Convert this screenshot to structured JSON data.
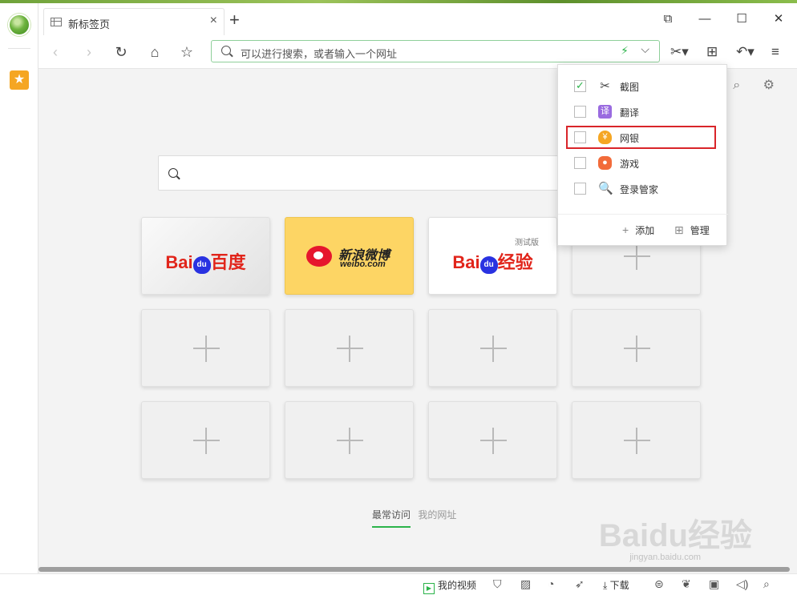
{
  "tab": {
    "title": "新标签页",
    "close": "×"
  },
  "new_tab": "+",
  "window_controls": {
    "restore": "⧉",
    "minimize": "—",
    "maximize": "☐",
    "close": "✕"
  },
  "nav": {
    "back": "‹",
    "forward": "›",
    "reload": "↻",
    "home": "⌂",
    "favorite": "☆"
  },
  "address": {
    "placeholder": "可以进行搜索，或者输入一个网址",
    "bolt": "⚡",
    "dropdown": "⌵"
  },
  "toolbar": {
    "scissors": "✂▾",
    "apps": "⊞",
    "undo": "↶▾",
    "menu": "≡"
  },
  "content_tools": {
    "search": "⌕",
    "settings": "⚙"
  },
  "tiles": [
    {
      "kind": "baidu",
      "brand_left": "Bai",
      "brand_paw": "du",
      "brand_right": "百度"
    },
    {
      "kind": "weibo",
      "cn": "新浪微博",
      "en": "weibo.com"
    },
    {
      "kind": "jingyan",
      "brand_left": "Bai",
      "brand_paw": "du",
      "brand_right": "经验",
      "beta": "测试版"
    },
    {
      "kind": "empty"
    },
    {
      "kind": "empty"
    },
    {
      "kind": "empty"
    },
    {
      "kind": "empty"
    },
    {
      "kind": "empty"
    },
    {
      "kind": "empty"
    },
    {
      "kind": "empty"
    },
    {
      "kind": "empty"
    },
    {
      "kind": "empty"
    }
  ],
  "bottom_tabs": [
    "最常访问",
    "我的网址"
  ],
  "watermark": {
    "text": "Baidu经验",
    "sub": "jingyan.baidu.com"
  },
  "statusbar": {
    "video": "我的视频",
    "download": "下载"
  },
  "dropdown": {
    "items": [
      {
        "label": "截图",
        "checked": true,
        "icon": "scissors-icon",
        "glyph": "✂"
      },
      {
        "label": "翻译",
        "checked": false,
        "icon": "translate-icon",
        "glyph": "译"
      },
      {
        "label": "网银",
        "checked": false,
        "icon": "bank-shield-icon",
        "glyph": "¥"
      },
      {
        "label": "游戏",
        "checked": false,
        "icon": "gamepad-icon",
        "glyph": "●"
      },
      {
        "label": "登录管家",
        "checked": false,
        "icon": "login-manager-icon",
        "glyph": "🔍"
      }
    ],
    "add_label": "添加",
    "manage_label": "管理",
    "add_glyph": "+",
    "manage_glyph": "⊞"
  },
  "colors": {
    "accent": "#2bb34a",
    "highlight": "#d9252a",
    "weibo_bg": "#fdd564"
  }
}
